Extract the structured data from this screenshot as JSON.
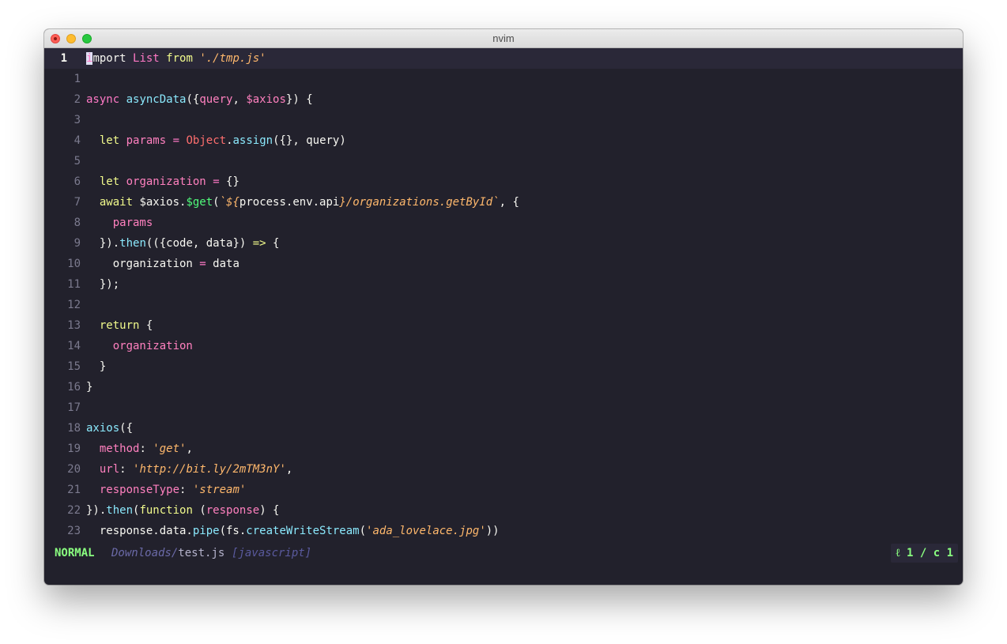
{
  "window": {
    "title": "nvim"
  },
  "editor": {
    "current_line_number": "1",
    "cursor_char": "i",
    "lines": [
      {
        "n": "1",
        "tokens": [
          [
            "mport ",
            "plain"
          ],
          [
            "List",
            "kw2"
          ],
          [
            " ",
            "plain"
          ],
          [
            "from",
            "kw"
          ],
          [
            " ",
            "plain"
          ],
          [
            "'./tmp.js'",
            "str"
          ]
        ]
      },
      {
        "n": "1",
        "tokens": []
      },
      {
        "n": "2",
        "tokens": [
          [
            "async",
            "kw2"
          ],
          [
            " ",
            "plain"
          ],
          [
            "asyncData",
            "fn"
          ],
          [
            "({",
            "plain"
          ],
          [
            "query",
            "param"
          ],
          [
            ", ",
            "plain"
          ],
          [
            "$axios",
            "param"
          ],
          [
            "}) {",
            "plain"
          ]
        ]
      },
      {
        "n": "3",
        "tokens": []
      },
      {
        "n": "4",
        "tokens": [
          [
            "  ",
            "plain"
          ],
          [
            "let",
            "kw"
          ],
          [
            " ",
            "plain"
          ],
          [
            "params",
            "prop"
          ],
          [
            " ",
            "plain"
          ],
          [
            "=",
            "op"
          ],
          [
            " ",
            "plain"
          ],
          [
            "Object",
            "obj"
          ],
          [
            ".",
            "plain"
          ],
          [
            "assign",
            "fn"
          ],
          [
            "({}, query)",
            "plain"
          ]
        ]
      },
      {
        "n": "5",
        "tokens": []
      },
      {
        "n": "6",
        "tokens": [
          [
            "  ",
            "plain"
          ],
          [
            "let",
            "kw"
          ],
          [
            " ",
            "plain"
          ],
          [
            "organization",
            "prop"
          ],
          [
            " ",
            "plain"
          ],
          [
            "=",
            "op"
          ],
          [
            " {}",
            "plain"
          ]
        ]
      },
      {
        "n": "7",
        "tokens": [
          [
            "  ",
            "plain"
          ],
          [
            "await",
            "kw"
          ],
          [
            " $axios.",
            "plain"
          ],
          [
            "$get",
            "fn2"
          ],
          [
            "(",
            "plain"
          ],
          [
            "`${",
            "str"
          ],
          [
            "process.env.api",
            "plain"
          ],
          [
            "}/organizations.getById`",
            "str"
          ],
          [
            ", {",
            "plain"
          ]
        ]
      },
      {
        "n": "8",
        "tokens": [
          [
            "    ",
            "plain"
          ],
          [
            "params",
            "prop"
          ]
        ]
      },
      {
        "n": "9",
        "tokens": [
          [
            "  }).",
            "plain"
          ],
          [
            "then",
            "fn"
          ],
          [
            "(({code, data}) ",
            "plain"
          ],
          [
            "=>",
            "arrow"
          ],
          [
            " {",
            "plain"
          ]
        ]
      },
      {
        "n": "10",
        "tokens": [
          [
            "    organization ",
            "plain"
          ],
          [
            "=",
            "op"
          ],
          [
            " data",
            "plain"
          ]
        ]
      },
      {
        "n": "11",
        "tokens": [
          [
            "  });",
            "plain"
          ]
        ]
      },
      {
        "n": "12",
        "tokens": []
      },
      {
        "n": "13",
        "tokens": [
          [
            "  ",
            "plain"
          ],
          [
            "return",
            "kw"
          ],
          [
            " {",
            "plain"
          ]
        ]
      },
      {
        "n": "14",
        "tokens": [
          [
            "    ",
            "plain"
          ],
          [
            "organization",
            "prop"
          ]
        ]
      },
      {
        "n": "15",
        "tokens": [
          [
            "  }",
            "plain"
          ]
        ]
      },
      {
        "n": "16",
        "tokens": [
          [
            "}",
            "plain"
          ]
        ]
      },
      {
        "n": "17",
        "tokens": []
      },
      {
        "n": "18",
        "tokens": [
          [
            "axios",
            "fn"
          ],
          [
            "({",
            "plain"
          ]
        ]
      },
      {
        "n": "19",
        "tokens": [
          [
            "  ",
            "plain"
          ],
          [
            "method",
            "prop"
          ],
          [
            ": ",
            "plain"
          ],
          [
            "'get'",
            "str"
          ],
          [
            ",",
            "plain"
          ]
        ]
      },
      {
        "n": "20",
        "tokens": [
          [
            "  ",
            "plain"
          ],
          [
            "url",
            "prop"
          ],
          [
            ": ",
            "plain"
          ],
          [
            "'http://bit.ly/2mTM3nY'",
            "str"
          ],
          [
            ",",
            "plain"
          ]
        ]
      },
      {
        "n": "21",
        "tokens": [
          [
            "  ",
            "plain"
          ],
          [
            "responseType",
            "prop"
          ],
          [
            ": ",
            "plain"
          ],
          [
            "'stream'",
            "str"
          ]
        ]
      },
      {
        "n": "22",
        "tokens": [
          [
            "}).",
            "plain"
          ],
          [
            "then",
            "fn"
          ],
          [
            "(",
            "plain"
          ],
          [
            "function",
            "kw"
          ],
          [
            " (",
            "plain"
          ],
          [
            "response",
            "param"
          ],
          [
            ") {",
            "plain"
          ]
        ]
      },
      {
        "n": "23",
        "tokens": [
          [
            "  response.data.",
            "plain"
          ],
          [
            "pipe",
            "fn"
          ],
          [
            "(fs.",
            "plain"
          ],
          [
            "createWriteStream",
            "fn"
          ],
          [
            "(",
            "plain"
          ],
          [
            "'ada_lovelace.jpg'",
            "str"
          ],
          [
            "))",
            "plain"
          ]
        ]
      }
    ]
  },
  "statusbar": {
    "mode": "NORMAL",
    "dir": "Downloads/",
    "file": "test.js",
    "filetype": "[javascript]",
    "position": "ℓ 1 / c 1"
  }
}
